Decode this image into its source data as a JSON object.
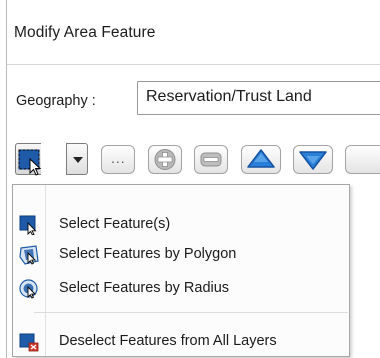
{
  "dialog": {
    "title": "Modify Area Feature"
  },
  "geography": {
    "label": "Geography :",
    "value": "Reservation/Trust Land"
  },
  "toolbar": {
    "select_tool_icon": "select-feature-icon",
    "dropdown_icon": "chevron-down-icon",
    "ellipsis_label": "...",
    "plus_icon": "plus-icon",
    "minus_icon": "minus-icon",
    "up_icon": "triangle-up-icon",
    "down_icon": "triangle-down-icon"
  },
  "menu": {
    "items": [
      {
        "label": "Select Feature(s)",
        "icon": "select-feature-icon"
      },
      {
        "label": "Select Features by Polygon",
        "icon": "polygon-select-icon"
      },
      {
        "label": "Select Features by Radius",
        "icon": "radius-select-icon"
      },
      {
        "label": "Deselect Features from All Layers",
        "icon": "deselect-icon"
      }
    ]
  },
  "colors": {
    "accent_blue": "#1e5aa8",
    "arrow_blue": "#2a7fd8",
    "deselect_red": "#d23b2c"
  }
}
